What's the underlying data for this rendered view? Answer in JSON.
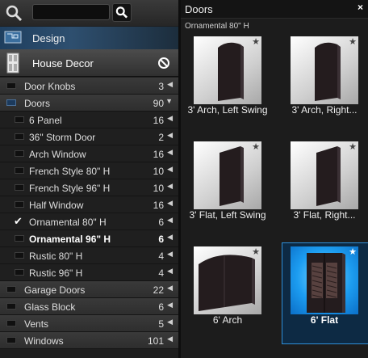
{
  "search": {
    "value": "",
    "placeholder": ""
  },
  "design": {
    "label": "Design"
  },
  "house": {
    "label": "House Decor"
  },
  "tree": [
    {
      "label": "Door Knobs",
      "count": "3",
      "level": 1,
      "expanded": false
    },
    {
      "label": "Doors",
      "count": "90",
      "level": 1,
      "expanded": true
    },
    {
      "label": "6 Panel",
      "count": "16",
      "level": 2
    },
    {
      "label": "36\" Storm Door",
      "count": "2",
      "level": 2
    },
    {
      "label": "Arch Window",
      "count": "16",
      "level": 2
    },
    {
      "label": "French Style 80\" H",
      "count": "10",
      "level": 2
    },
    {
      "label": "French Style 96\" H",
      "count": "10",
      "level": 2
    },
    {
      "label": "Half Window",
      "count": "16",
      "level": 2
    },
    {
      "label": "Ornamental 80\" H",
      "count": "6",
      "level": 2,
      "checked": true
    },
    {
      "label": "Ornamental 96\" H",
      "count": "6",
      "level": 2,
      "bold": true
    },
    {
      "label": "Rustic 80\" H",
      "count": "4",
      "level": 2
    },
    {
      "label": "Rustic 96\" H",
      "count": "4",
      "level": 2
    },
    {
      "label": "Garage Doors",
      "count": "22",
      "level": 1
    },
    {
      "label": "Glass Block",
      "count": "6",
      "level": 1
    },
    {
      "label": "Vents",
      "count": "5",
      "level": 1
    },
    {
      "label": "Windows",
      "count": "101",
      "level": 1
    }
  ],
  "panel": {
    "title": "Doors",
    "close": "×",
    "subtitle": "Ornamental 80\" H",
    "items": [
      {
        "caption": "3' Arch, Left Swing",
        "shape": "arch-left"
      },
      {
        "caption": "3' Arch, Right...",
        "shape": "arch-right"
      },
      {
        "caption": "3' Flat, Left Swing",
        "shape": "flat-left"
      },
      {
        "caption": "3' Flat, Right...",
        "shape": "flat-right"
      },
      {
        "caption": "6' Arch",
        "shape": "double-arch"
      },
      {
        "caption": "6' Flat",
        "shape": "double-flat",
        "selected": true
      }
    ]
  },
  "icons": {
    "zoom": "magnifier-icon",
    "search": "search-icon",
    "design": "blueprint-icon",
    "house": "door-icon",
    "no": "no-entry-icon",
    "star": "star-icon"
  }
}
